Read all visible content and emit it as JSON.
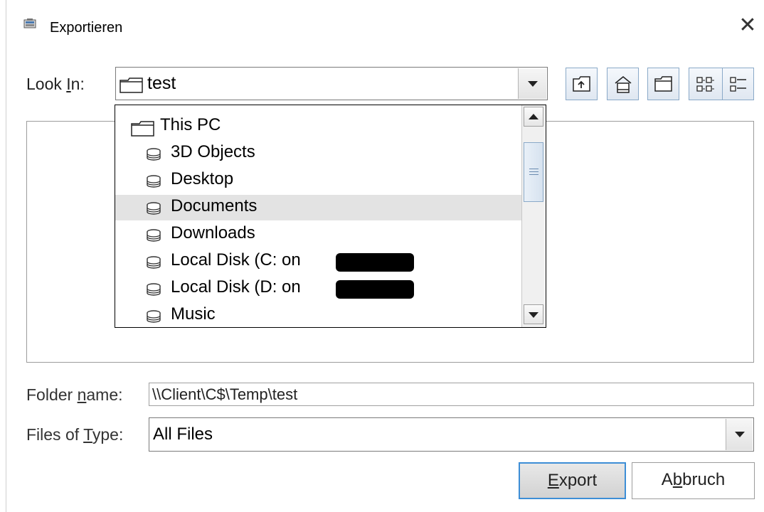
{
  "window": {
    "title": "Exportieren",
    "close_glyph": "✕"
  },
  "look_in": {
    "label_prefix": "Look ",
    "label_mnemonic": "I",
    "label_suffix": "n:",
    "selected_value": "test"
  },
  "toolbar": {
    "buttons": [
      "up-one-level-icon",
      "home-icon",
      "new-folder-icon",
      "list-view-icon",
      "details-view-icon"
    ]
  },
  "dropdown": {
    "items": [
      {
        "label": "This PC",
        "icon": "folder-icon"
      },
      {
        "label": "3D Objects",
        "icon": "drive-icon"
      },
      {
        "label": "Desktop",
        "icon": "drive-icon"
      },
      {
        "label": "Documents",
        "icon": "drive-icon",
        "selected": true
      },
      {
        "label": "Downloads",
        "icon": "drive-icon"
      },
      {
        "label": "Local Disk (C: on",
        "icon": "drive-icon",
        "redacted_suffix": true
      },
      {
        "label": "Local Disk (D: on",
        "icon": "drive-icon",
        "redacted_suffix": true
      },
      {
        "label": "Music",
        "icon": "drive-icon"
      }
    ]
  },
  "folder_name": {
    "label_prefix": "Folder ",
    "label_mnemonic": "n",
    "label_suffix": "ame:",
    "value": "\\\\Client\\C$\\Temp\\test"
  },
  "files_of_type": {
    "label_prefix": "Files of ",
    "label_mnemonic": "T",
    "label_suffix": "ype:",
    "selected_value": "All Files"
  },
  "buttons": {
    "export_mnemonic": "E",
    "export_rest": "xport",
    "cancel_prefix": "A",
    "cancel_mnemonic": "b",
    "cancel_rest": "bruch"
  },
  "colors": {
    "accent_border": "#3d8ed6",
    "selection_bg": "#e3e3e3"
  }
}
